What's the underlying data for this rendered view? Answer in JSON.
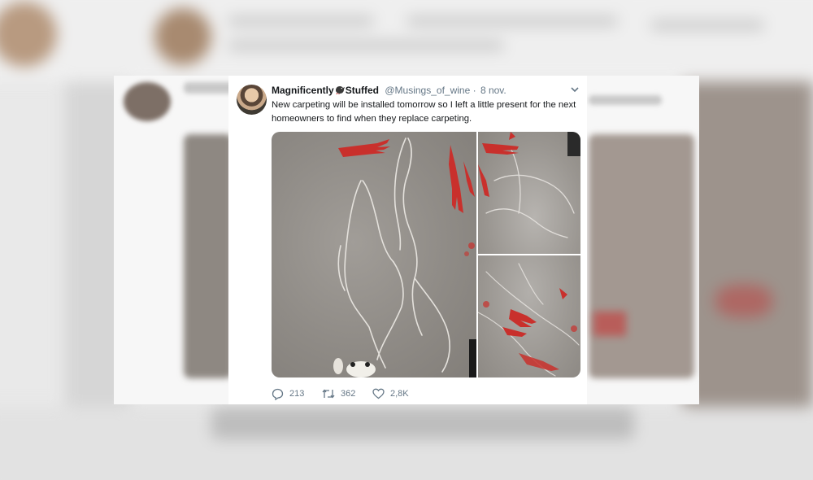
{
  "tweet": {
    "display_name_part1": "Magnificently",
    "display_name_part2": "Stuffed",
    "handle": "@Musings_of_wine",
    "separator": "·",
    "date": "8 nov.",
    "text": "New carpeting will be installed tomorrow so I left a little present for the next homeowners to find when they replace carpeting.",
    "icons": {
      "bird": "bird-emoji-icon",
      "menu": "chevron-down-icon",
      "reply": "reply-icon",
      "retweet": "retweet-icon",
      "like": "heart-icon"
    },
    "stats": {
      "replies": "213",
      "retweets": "362",
      "likes": "2,8K"
    }
  },
  "colors": {
    "text_primary": "#14171a",
    "text_secondary": "#657786",
    "blood_red": "#c9302c",
    "floor_gray": "#8f8b86"
  }
}
